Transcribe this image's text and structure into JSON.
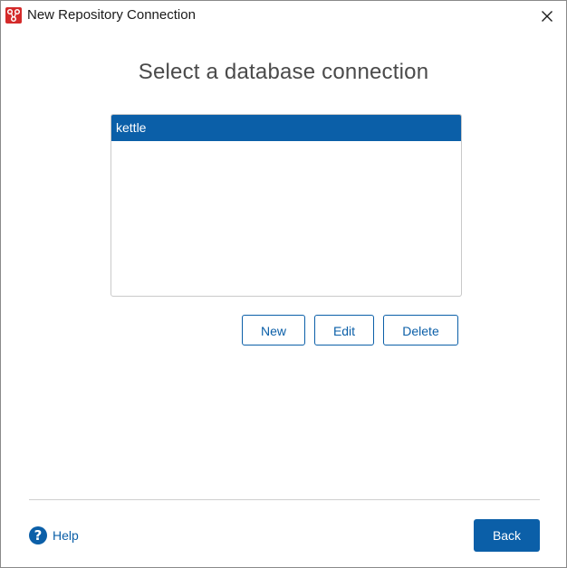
{
  "window": {
    "title": "New Repository Connection",
    "icon": "pentaho-app-icon",
    "close_icon": "close-icon"
  },
  "main": {
    "heading": "Select a database connection",
    "connections": [
      {
        "label": "kettle",
        "selected": true
      }
    ],
    "buttons": {
      "new_label": "New",
      "edit_label": "Edit",
      "delete_label": "Delete"
    }
  },
  "footer": {
    "help_label": "Help",
    "help_icon": "question-circle-icon",
    "back_label": "Back"
  },
  "colors": {
    "accent": "#0b5fa8",
    "app_icon": "#d42a2a",
    "heading_text": "#4a4a4a"
  }
}
